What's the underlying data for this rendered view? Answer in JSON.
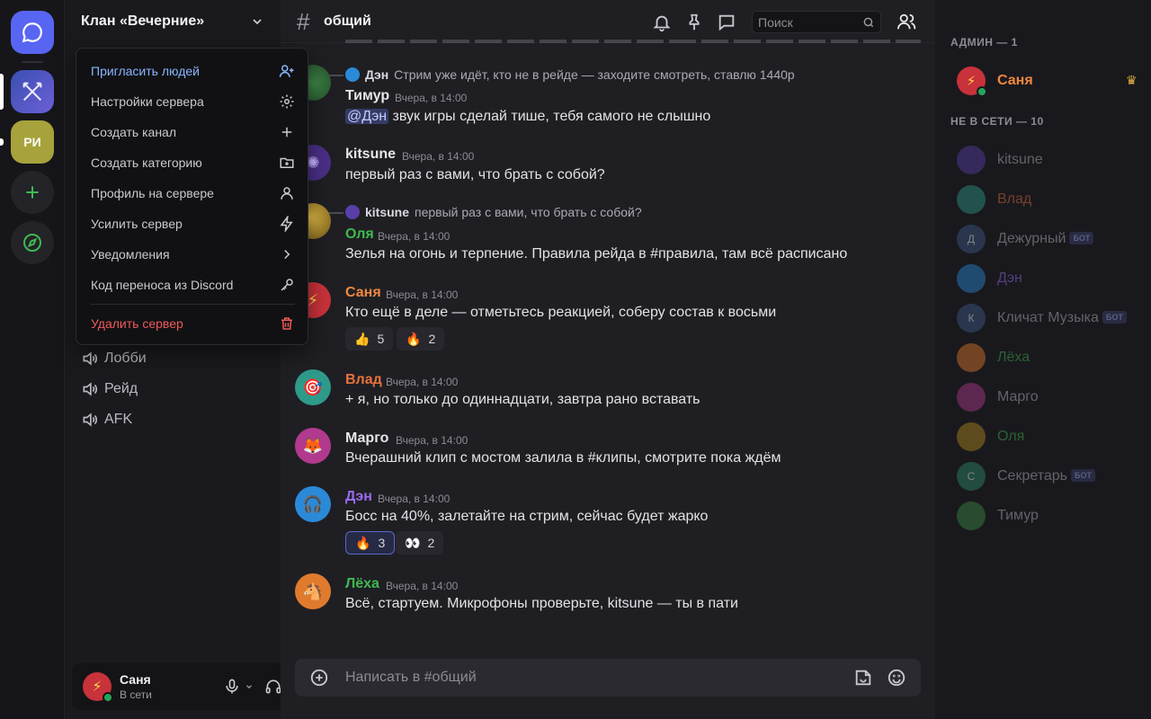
{
  "servers": {
    "initials": "РИ"
  },
  "server": {
    "name": "Клан «Вечерние»"
  },
  "menu": [
    {
      "label": "Пригласить людей",
      "icon": "add-user-icon"
    },
    {
      "label": "Настройки сервера",
      "icon": "gear-icon"
    },
    {
      "label": "Создать канал",
      "icon": "plus-icon"
    },
    {
      "label": "Создать категорию",
      "icon": "folder-plus-icon"
    },
    {
      "label": "Профиль на сервере",
      "icon": "user-icon"
    },
    {
      "label": "Усилить сервер",
      "icon": "bolt-icon"
    },
    {
      "label": "Уведомления",
      "icon": "chevron-right-icon"
    },
    {
      "label": "Код переноса из Discord",
      "icon": "key-icon"
    },
    {
      "label": "Удалить сервер",
      "icon": "trash-icon"
    }
  ],
  "voice_channels": [
    "Лобби",
    "Рейд",
    "AFK"
  ],
  "user": {
    "name": "Саня",
    "status": "В сети"
  },
  "channel": {
    "name": "общий",
    "search_placeholder": "Поиск"
  },
  "messages": [
    {
      "reply": {
        "author": "Дэн",
        "text": "Стрим уже идёт, кто не в рейде — заходите смотреть, ставлю 1440p"
      },
      "author": "Тимур",
      "time": "Вчера, в 14:00",
      "mention": "@Дэн",
      "text": "звук игры сделай тише, тебя самого не слышно"
    },
    {
      "author": "kitsune",
      "time": "Вчера, в 14:00",
      "text": "первый раз с вами, что брать с собой?"
    },
    {
      "reply": {
        "author": "kitsune",
        "text": "первый раз с вами, что брать с собой?"
      },
      "author": "Оля",
      "time": "Вчера, в 14:00",
      "text": "Зелья на огонь и терпение. Правила рейда в #правила, там всё расписано"
    },
    {
      "author": "Саня",
      "time": "Вчера, в 14:00",
      "text": "Кто ещё в деле — отметьтесь реакцией, соберу состав к восьми",
      "reactions": [
        {
          "emoji": "👍",
          "count": "5"
        },
        {
          "emoji": "🔥",
          "count": "2"
        }
      ]
    },
    {
      "author": "Влад",
      "time": "Вчера, в 14:00",
      "text": "+ я, но только до одиннадцати, завтра рано вставать"
    },
    {
      "author": "Марго",
      "time": "Вчера, в 14:00",
      "text": "Вчерашний клип с мостом залила в #клипы, смотрите пока ждём"
    },
    {
      "author": "Дэн",
      "time": "Вчера, в 14:00",
      "text": "Босс на 40%, залетайте на стрим, сейчас будет жарко",
      "reactions": [
        {
          "emoji": "🔥",
          "count": "3"
        },
        {
          "emoji": "👀",
          "count": "2"
        }
      ]
    },
    {
      "author": "Лёха",
      "time": "Вчера, в 14:00",
      "text": "Всё, стартуем. Микрофоны проверьте, kitsune — ты в пати"
    }
  ],
  "composer": {
    "placeholder": "Написать в #общий"
  },
  "members": {
    "admin_header": "АДМИН — 1",
    "offline_header": "НЕ В СЕТИ — 10",
    "admin": [
      {
        "name": "Саня"
      }
    ],
    "offline": [
      {
        "name": "kitsune",
        "avatar": ""
      },
      {
        "name": "Влад",
        "avatar": ""
      },
      {
        "name": "Дежурный",
        "avatar": "Д",
        "bot": "БОТ"
      },
      {
        "name": "Дэн",
        "avatar": ""
      },
      {
        "name": "Кличат Музыка",
        "avatar": "К",
        "bot": "БОТ"
      },
      {
        "name": "Лёха",
        "avatar": ""
      },
      {
        "name": "Марго",
        "avatar": ""
      },
      {
        "name": "Оля",
        "avatar": ""
      },
      {
        "name": "Секретарь",
        "avatar": "С",
        "bot": "БОТ"
      },
      {
        "name": "Тимур",
        "avatar": ""
      }
    ]
  },
  "colors": {
    "accent": "#5865f2",
    "online": "#23a55a",
    "sanya": "#f0883e",
    "vlad": "#e8713c",
    "den": "#9b6cf0",
    "olya": "#3fb950",
    "lyoha": "#3fb950",
    "danger": "#ef5a5a"
  }
}
